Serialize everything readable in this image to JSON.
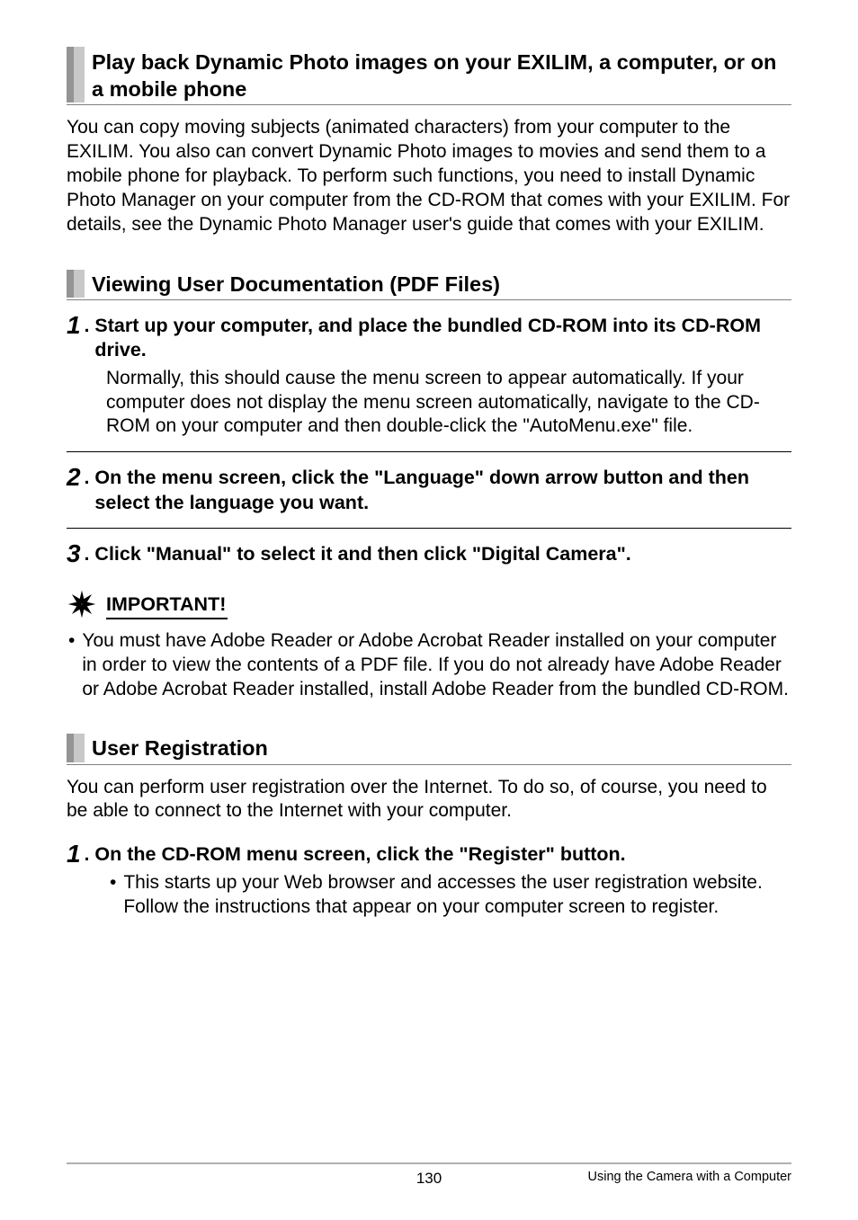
{
  "section1": {
    "heading": "Play back Dynamic Photo images on your EXILIM, a computer, or on a mobile phone",
    "body": "You can copy moving subjects (animated characters) from your computer to the EXILIM. You also can convert Dynamic Photo images to movies and send them to a mobile phone for playback. To perform such functions, you need to install Dynamic Photo Manager on your computer from the CD-ROM that comes with your EXILIM. For details, see the Dynamic Photo Manager user's guide that comes with your EXILIM."
  },
  "section2": {
    "heading": "Viewing User Documentation (PDF Files)",
    "steps": [
      {
        "num": "1",
        "title": "Start up your computer, and place the bundled CD-ROM into its CD-ROM drive.",
        "body": "Normally, this should cause the menu screen to appear automatically. If your computer does not display the menu screen automatically, navigate to the CD-ROM on your computer and then double-click the \"AutoMenu.exe\" file."
      },
      {
        "num": "2",
        "title": "On the menu screen, click the \"Language\" down arrow button and then select the language you want.",
        "body": ""
      },
      {
        "num": "3",
        "title": "Click \"Manual\" to select it and then click \"Digital Camera\".",
        "body": ""
      }
    ],
    "important_label": "IMPORTANT!",
    "important_body": "You must have Adobe Reader or Adobe Acrobat Reader installed on your computer in order to view the contents of a PDF file. If you do not already have Adobe Reader or Adobe Acrobat Reader installed, install Adobe Reader from the bundled CD-ROM."
  },
  "section3": {
    "heading": "User Registration",
    "body": "You can perform user registration over the Internet. To do so, of course, you need to be able to connect to the Internet with your computer.",
    "step": {
      "num": "1",
      "title": "On the CD-ROM menu screen, click the \"Register\" button.",
      "sub": "This starts up your Web browser and accesses the user registration website. Follow the instructions that appear on your computer screen to register."
    }
  },
  "footer": {
    "page": "130",
    "chapter": "Using the Camera with a Computer"
  }
}
